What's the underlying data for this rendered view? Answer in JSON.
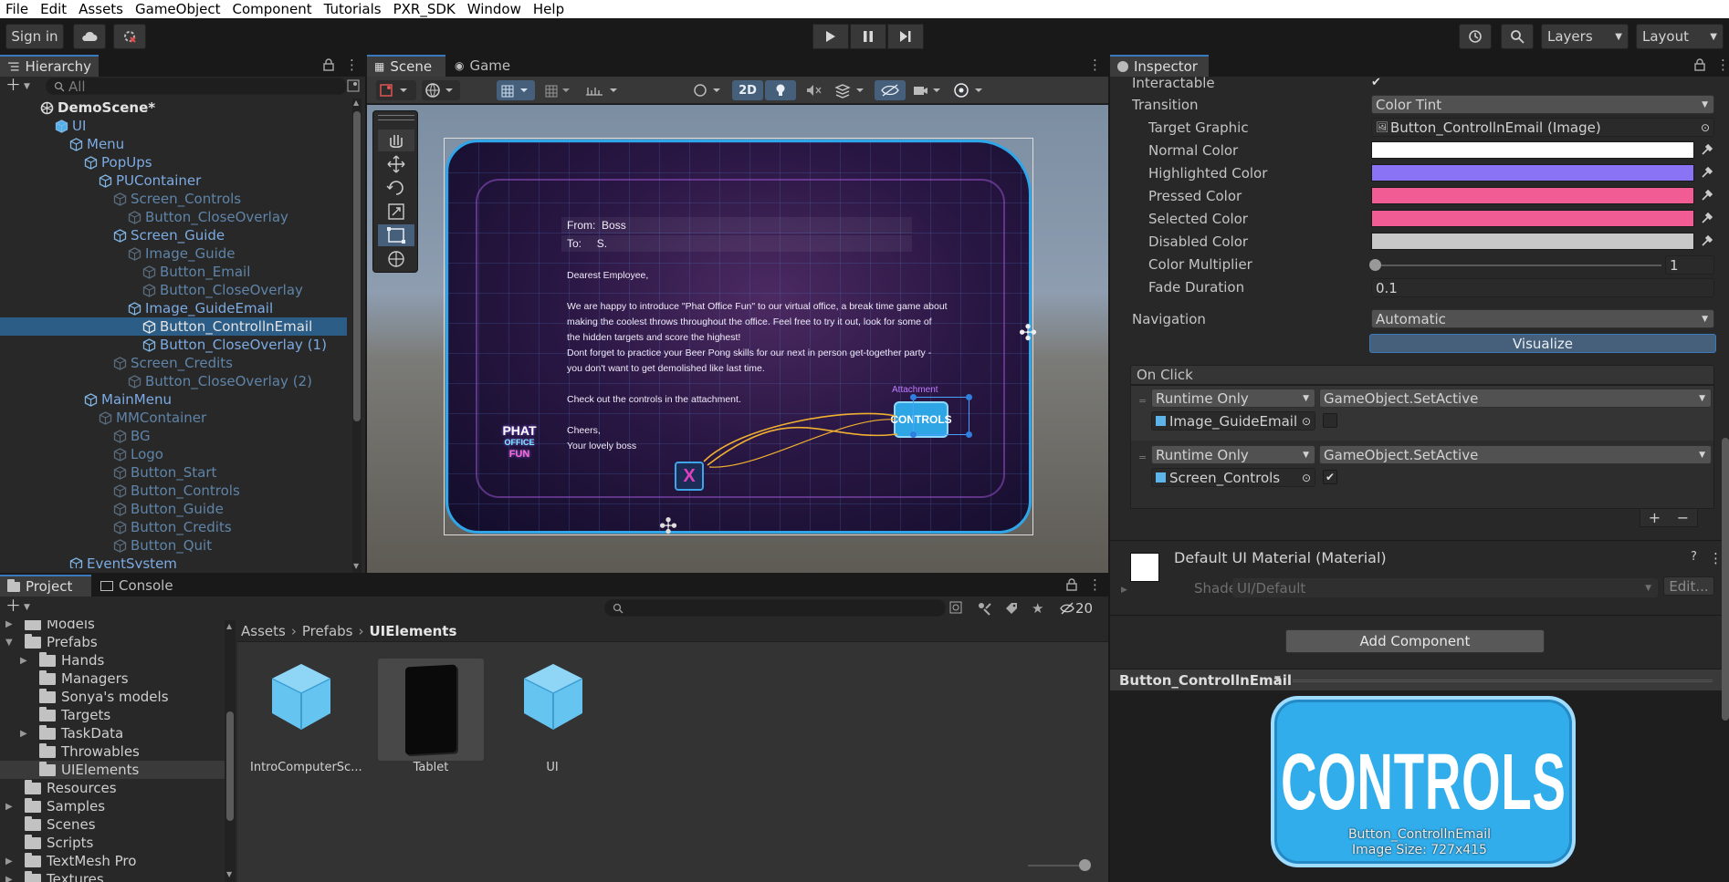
{
  "menu": [
    "File",
    "Edit",
    "Assets",
    "GameObject",
    "Component",
    "Tutorials",
    "PXR_SDK",
    "Window",
    "Help"
  ],
  "toolbar": {
    "sign_in": "Sign in",
    "layers": "Layers",
    "layout": "Layout"
  },
  "hierarchy": {
    "tab": "Hierarchy",
    "search_placeholder": "All",
    "items": [
      {
        "label": "DemoScene*",
        "depth": 0,
        "style": "scene"
      },
      {
        "label": "UI",
        "depth": 1,
        "style": "blue"
      },
      {
        "label": "Menu",
        "depth": 2,
        "style": "blue"
      },
      {
        "label": "PopUps",
        "depth": 3,
        "style": "blue"
      },
      {
        "label": "PUContainer",
        "depth": 4,
        "style": "blue"
      },
      {
        "label": "Screen_Controls",
        "depth": 5,
        "style": "dim"
      },
      {
        "label": "Button_CloseOverlay",
        "depth": 6,
        "style": "dim"
      },
      {
        "label": "Screen_Guide",
        "depth": 5,
        "style": "blue"
      },
      {
        "label": "Image_Guide",
        "depth": 6,
        "style": "dim"
      },
      {
        "label": "Button_Email",
        "depth": 7,
        "style": "dim"
      },
      {
        "label": "Button_CloseOverlay",
        "depth": 7,
        "style": "dim"
      },
      {
        "label": "Image_GuideEmail",
        "depth": 6,
        "style": "blue"
      },
      {
        "label": "Button_ControllnEmail",
        "depth": 7,
        "style": "white",
        "selected": true
      },
      {
        "label": "Button_CloseOverlay (1)",
        "depth": 7,
        "style": "blue"
      },
      {
        "label": "Screen_Credits",
        "depth": 5,
        "style": "dim"
      },
      {
        "label": "Button_CloseOverlay (2)",
        "depth": 6,
        "style": "dim"
      },
      {
        "label": "MainMenu",
        "depth": 3,
        "style": "blue"
      },
      {
        "label": "MMContainer",
        "depth": 4,
        "style": "dim"
      },
      {
        "label": "BG",
        "depth": 5,
        "style": "dim"
      },
      {
        "label": "Logo",
        "depth": 5,
        "style": "dim"
      },
      {
        "label": "Button_Start",
        "depth": 5,
        "style": "dim"
      },
      {
        "label": "Button_Controls",
        "depth": 5,
        "style": "dim"
      },
      {
        "label": "Button_Guide",
        "depth": 5,
        "style": "dim"
      },
      {
        "label": "Button_Credits",
        "depth": 5,
        "style": "dim"
      },
      {
        "label": "Button_Quit",
        "depth": 5,
        "style": "dim"
      },
      {
        "label": "EventSystem",
        "depth": 2,
        "style": "blue"
      }
    ]
  },
  "scene": {
    "tab_scene": "Scene",
    "tab_game": "Game",
    "mode_2d": "2D",
    "email": {
      "from_label": "From:",
      "from": "Boss",
      "to_label": "To:",
      "to": "S.",
      "greeting": "Dearest Employee,",
      "body1": "We are happy to introduce \"Phat Office Fun\" to our virtual office, a break time game about",
      "body2": "making the coolest throws throughout the office. Feel free to try it out, look for some of",
      "body3": "the hidden targets and score the highest!",
      "body4": "Dont forget to practice your Beer Pong skills for our next in person get-together party -",
      "body5": "you don't want to get demolished like last time.",
      "body6": "Check out the controls in the attachment.",
      "closing": "Cheers,",
      "signature": "Your lovely boss",
      "attachment": "Attachment",
      "controls_btn": "CONTROLS",
      "close_x": "X",
      "logo_line1": "PHAT",
      "logo_line2": "OFFICE",
      "logo_line3": "FUN"
    }
  },
  "inspector": {
    "tab": "Inspector",
    "interactable": "Interactable",
    "transition": "Transition",
    "transition_value": "Color Tint",
    "target_graphic": "Target Graphic",
    "target_graphic_value": "Button_ControllnEmail (Image)",
    "normal_color": "Normal Color",
    "highlighted_color": "Highlighted Color",
    "pressed_color": "Pressed Color",
    "selected_color": "Selected Color",
    "disabled_color": "Disabled Color",
    "color_multiplier": "Color Multiplier",
    "color_multiplier_value": "1",
    "fade_duration": "Fade Duration",
    "fade_duration_value": "0.1",
    "navigation": "Navigation",
    "navigation_value": "Automatic",
    "visualize": "Visualize",
    "on_click": "On Click",
    "events": [
      {
        "runtime": "Runtime Only",
        "function": "GameObject.SetActive",
        "object": "Image_GuideEmail",
        "checked": false
      },
      {
        "runtime": "Runtime Only",
        "function": "GameObject.SetActive",
        "object": "Screen_Controls",
        "checked": true
      }
    ],
    "material_title": "Default UI Material (Material)",
    "shader_label": "Shader",
    "shader_value": "UI/Default",
    "edit": "Edit...",
    "add_component": "Add Component",
    "preview_title": "Button_ControllnEmail",
    "preview_text": "CONTROLS",
    "preview_name": "Button_ControllnEmail",
    "preview_size": "Image Size: 727x415",
    "colors": {
      "normal": "#ffffff",
      "highlighted": "#8a73f5",
      "pressed": "#f25c94",
      "selected": "#f25c94",
      "disabled": "#c8c8c8"
    }
  },
  "project": {
    "tab_project": "Project",
    "tab_console": "Console",
    "hidden_count": "20",
    "breadcrumb": [
      "Assets",
      "Prefabs",
      "UIElements"
    ],
    "tree": [
      {
        "label": "Models",
        "depth": 1,
        "arrow": true
      },
      {
        "label": "Prefabs",
        "depth": 1,
        "arrow": true,
        "open": true
      },
      {
        "label": "Hands",
        "depth": 2,
        "arrow": true
      },
      {
        "label": "Managers",
        "depth": 2
      },
      {
        "label": "Sonya's models",
        "depth": 2
      },
      {
        "label": "Targets",
        "depth": 2
      },
      {
        "label": "TaskData",
        "depth": 2,
        "arrow": true
      },
      {
        "label": "Throwables",
        "depth": 2
      },
      {
        "label": "UIElements",
        "depth": 2,
        "selected": true
      },
      {
        "label": "Resources",
        "depth": 1
      },
      {
        "label": "Samples",
        "depth": 1,
        "arrow": true
      },
      {
        "label": "Scenes",
        "depth": 1
      },
      {
        "label": "Scripts",
        "depth": 1
      },
      {
        "label": "TextMesh Pro",
        "depth": 1,
        "arrow": true
      },
      {
        "label": "Textures",
        "depth": 1,
        "arrow": true
      }
    ],
    "assets": [
      {
        "label": "IntroComputerSc...",
        "kind": "cube"
      },
      {
        "label": "Tablet",
        "kind": "tablet"
      },
      {
        "label": "UI",
        "kind": "cube"
      }
    ]
  }
}
